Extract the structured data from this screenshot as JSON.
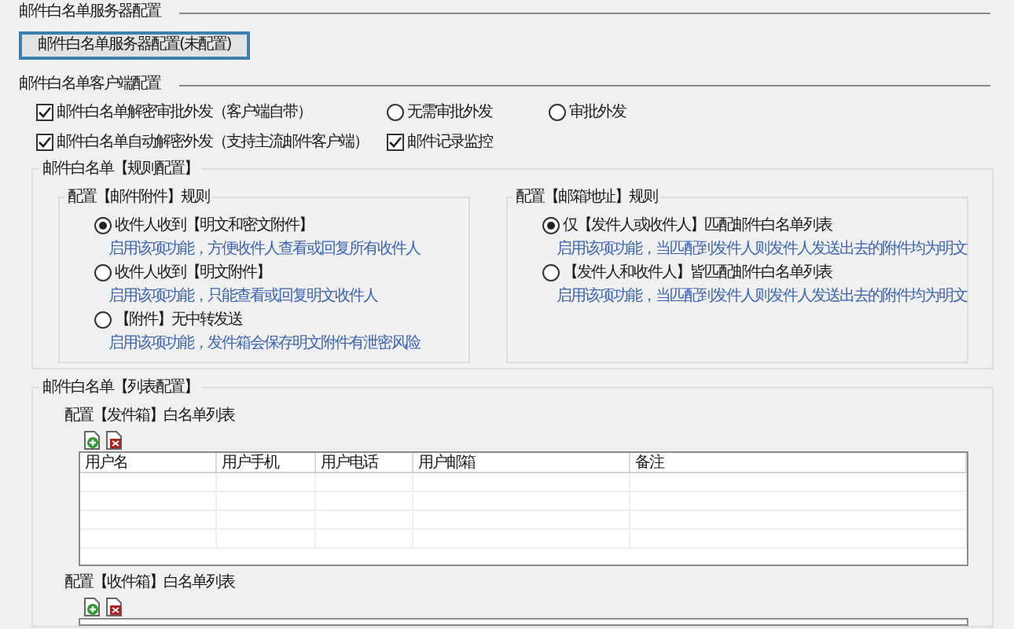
{
  "server_section": {
    "title": "邮件白名单服务器配置",
    "button": "邮件白名单服务器配置(未配置)"
  },
  "client_section": {
    "title": "邮件白名单客户端配置",
    "rows": [
      [
        {
          "kind": "checkbox",
          "label": "邮件白名单解密审批外发（客户端自带）",
          "checked": true
        },
        {
          "kind": "radio",
          "label": "无需审批外发",
          "selected": false
        },
        {
          "kind": "radio",
          "label": "审批外发",
          "selected": false
        }
      ],
      [
        {
          "kind": "checkbox",
          "label": "邮件白名单自动解密外发（支持主流邮件客户端）",
          "checked": true
        },
        {
          "kind": "checkbox",
          "label": "邮件记录监控",
          "checked": true
        }
      ]
    ]
  },
  "rules_group": {
    "title": "邮件白名单【规则配置】",
    "panels": [
      {
        "title": "配置【邮件附件】规则",
        "options": [
          {
            "label": "收件人收到【明文和密文附件】",
            "hint": "启用该项功能，方便收件人查看或回复所有收件人",
            "selected": true
          },
          {
            "label": "收件人收到【明文附件】",
            "hint": "启用该项功能，只能查看或回复明文收件人",
            "selected": false
          },
          {
            "label": "【附件】无中转发送",
            "hint": "启用该项功能，发件箱会保存明文附件有泄密风险",
            "selected": false
          }
        ]
      },
      {
        "title": "配置【邮箱地址】规则",
        "options": [
          {
            "label": "仅【发件人或收件人】匹配邮件白名单列表",
            "hint": "启用该项功能，当匹配到发件人则发件人发送出去的附件均为明文",
            "selected": true
          },
          {
            "label": "【发件人和收件人】皆匹配邮件白名单列表",
            "hint": "启用该项功能，当匹配到发件人则发件人发送出去的附件均为明文",
            "selected": false
          }
        ]
      }
    ]
  },
  "list_group": {
    "title": "邮件白名单【列表配置】",
    "lists": [
      {
        "title": "配置【发件箱】白名单列表",
        "columns": [
          "用户名",
          "用户手机",
          "用户电话",
          "用户邮箱",
          "备注"
        ]
      },
      {
        "title": "配置【收件箱】白名单列表"
      }
    ]
  }
}
